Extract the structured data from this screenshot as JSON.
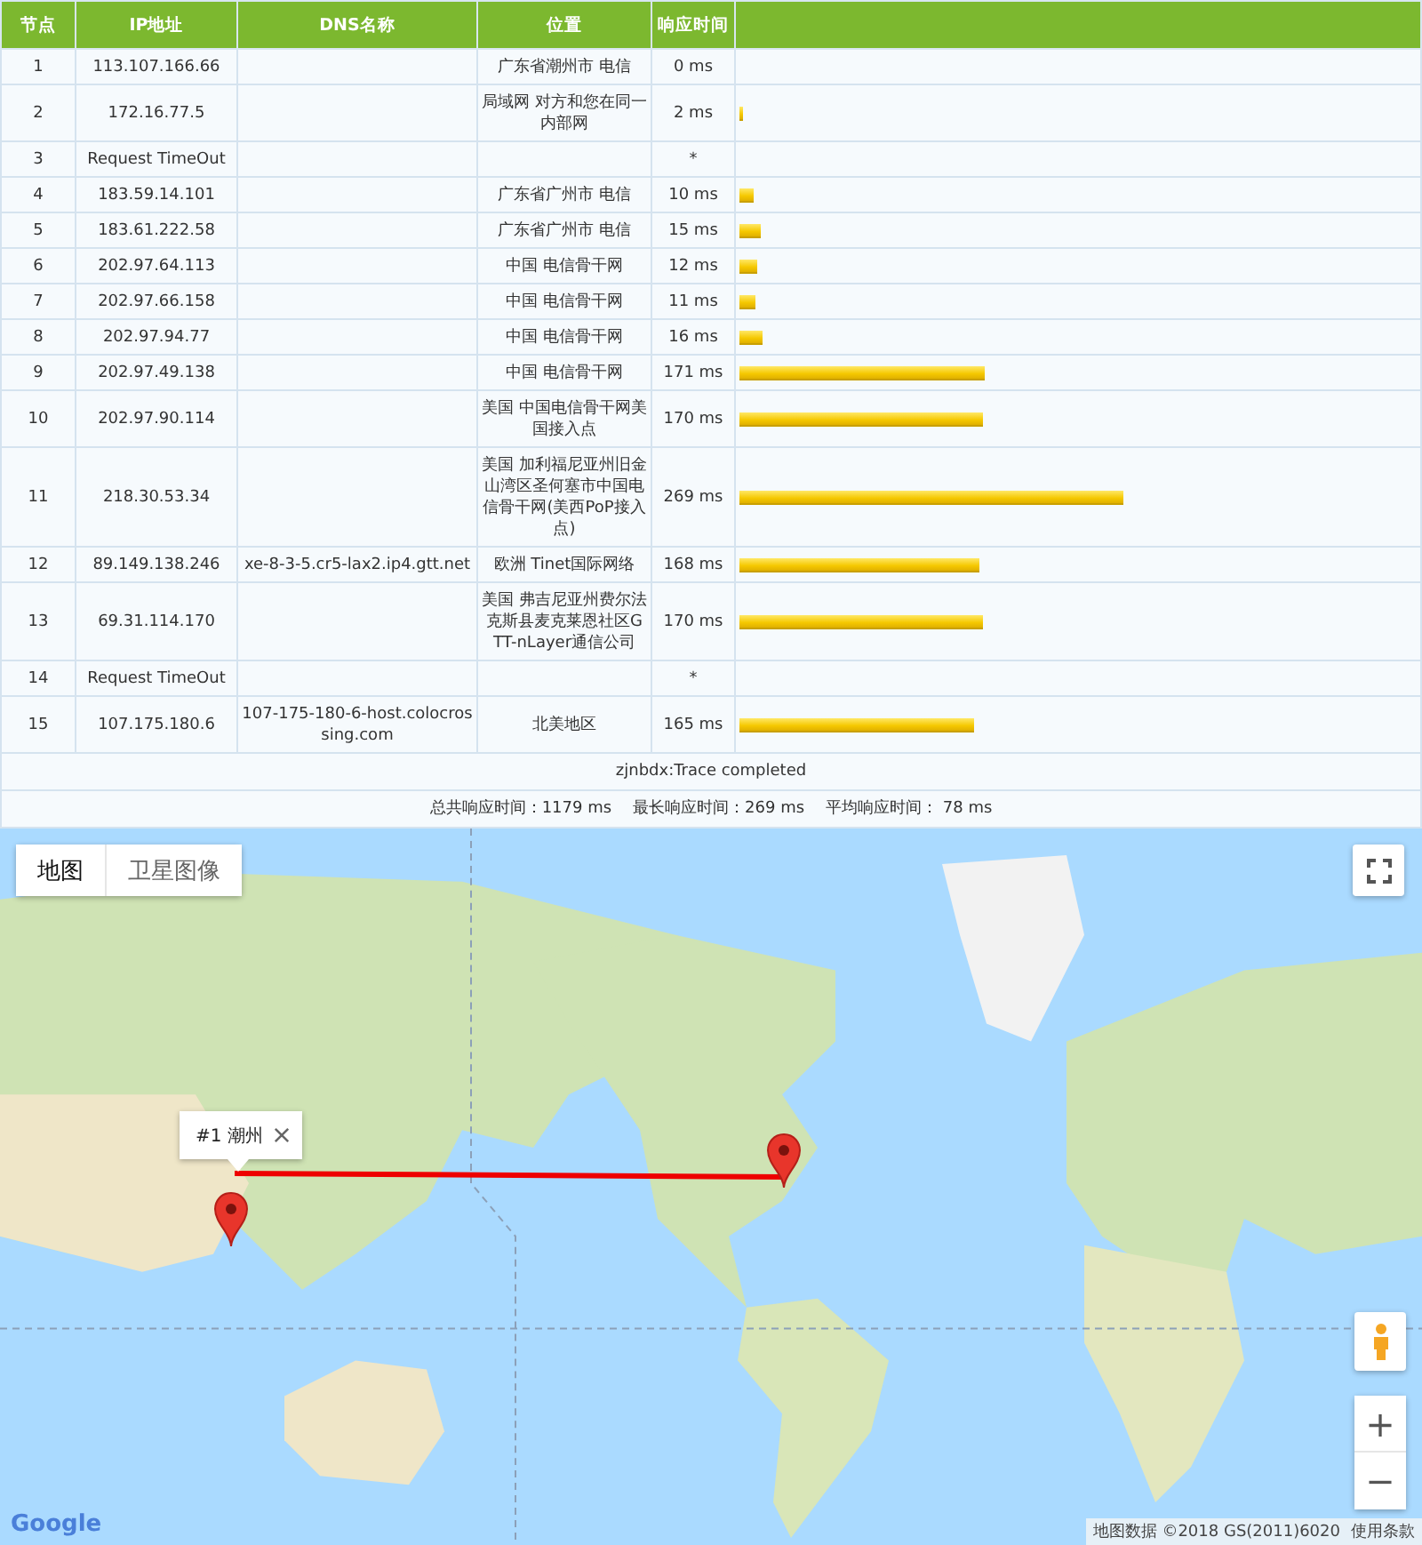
{
  "table": {
    "columns": [
      "节点",
      "IP地址",
      "DNS名称",
      "位置",
      "响应时间"
    ],
    "rows": [
      {
        "node": "1",
        "ip": "113.107.166.66",
        "location": "广东省潮州市 电信",
        "time": "0 ms"
      },
      {
        "node": "2",
        "ip": "172.16.77.5",
        "location": "局域网 对方和您在同一内部网",
        "time": "2 ms",
        "level": 0.004
      },
      {
        "node": "3",
        "ip": "Request TimeOut",
        "time": "*"
      },
      {
        "node": "4",
        "ip": "183.59.14.101",
        "location": "广东省广州市 电信",
        "time": "10 ms",
        "level": 0.021
      },
      {
        "node": "5",
        "ip": "183.61.222.58",
        "location": "广东省广州市 电信",
        "time": "15 ms",
        "level": 0.032
      },
      {
        "node": "6",
        "ip": "202.97.64.113",
        "location": "中国 电信骨干网",
        "time": "12 ms",
        "level": 0.025
      },
      {
        "node": "7",
        "ip": "202.97.66.158",
        "location": "中国 电信骨干网",
        "time": "11 ms",
        "level": 0.023
      },
      {
        "node": "8",
        "ip": "202.97.94.77",
        "location": "中国 电信骨干网",
        "time": "16 ms",
        "level": 0.034
      },
      {
        "node": "9",
        "ip": "202.97.49.138",
        "location": "中国 电信骨干网",
        "time": "171 ms",
        "level": 0.36
      },
      {
        "node": "10",
        "ip": "202.97.90.114",
        "location": "美国 中国电信骨干网美国接入点",
        "time": "170 ms",
        "level": 0.358
      },
      {
        "node": "11",
        "ip": "218.30.53.34",
        "location": "美国 加利福尼亚州旧金山湾区圣何塞市中国电信骨干网(美西PoP接入点)",
        "time": "269 ms",
        "level": 0.566
      },
      {
        "node": "12",
        "ip": "89.149.138.246",
        "dns": "xe-8-3-5.cr5-lax2.ip4.gtt.net",
        "location": "欧洲 Tinet国际网络",
        "time": "168 ms",
        "level": 0.353
      },
      {
        "node": "13",
        "ip": "69.31.114.170",
        "location": "美国 弗吉尼亚州费尔法克斯县麦克莱恩社区GTT-nLayer通信公司",
        "time": "170 ms",
        "level": 0.358
      },
      {
        "node": "14",
        "ip": "Request TimeOut",
        "time": "*"
      },
      {
        "node": "15",
        "ip": "107.175.180.6",
        "dns": "107-175-180-6-host.colocrossing.com",
        "location": "北美地区",
        "time": "165 ms",
        "level": 0.345
      }
    ],
    "status": "zjnbdx:Trace completed",
    "summary": [
      "总共响应时间：1179 ms",
      "最长响应时间：269 ms",
      "平均响应时间： 78 ms"
    ]
  },
  "map": {
    "map_types": [
      {
        "label": "地图",
        "selected": true
      },
      {
        "label": "卫星图像",
        "selected": false
      }
    ],
    "popup": {
      "label": "#1 潮州"
    },
    "zoom": [
      "+",
      "−"
    ],
    "logo": "Google",
    "attribution": "地图数据 ©2018 GS(2011)6020",
    "terms": "使用条款"
  }
}
